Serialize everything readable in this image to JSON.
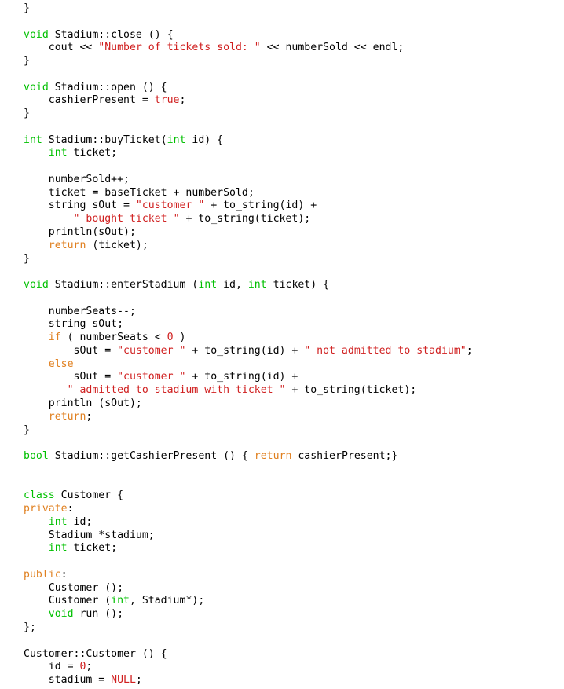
{
  "document": {
    "kind": "source-code-listing",
    "language": "C++",
    "background_color": "#ffffff"
  },
  "theme": {
    "plain_color": "#000000",
    "keyword_color": "#00c000",
    "string_color": "#d02020",
    "literal_color": "#d02020",
    "control_color": "#e08020"
  },
  "code": {
    "lines": [
      [
        {
          "t": "}",
          "c": "pln"
        }
      ],
      [],
      [
        {
          "t": "void",
          "c": "kw"
        },
        {
          "t": " Stadium::close () {",
          "c": "pln"
        }
      ],
      [
        {
          "t": "    cout << ",
          "c": "pln"
        },
        {
          "t": "\"Number of tickets sold: \"",
          "c": "str"
        },
        {
          "t": " << numberSold << endl;",
          "c": "pln"
        }
      ],
      [
        {
          "t": "}",
          "c": "pln"
        }
      ],
      [],
      [
        {
          "t": "void",
          "c": "kw"
        },
        {
          "t": " Stadium::open () {",
          "c": "pln"
        }
      ],
      [
        {
          "t": "    cashierPresent = ",
          "c": "pln"
        },
        {
          "t": "true",
          "c": "lit"
        },
        {
          "t": ";",
          "c": "pln"
        }
      ],
      [
        {
          "t": "}",
          "c": "pln"
        }
      ],
      [],
      [
        {
          "t": "int",
          "c": "kw"
        },
        {
          "t": " Stadium::buyTicket(",
          "c": "pln"
        },
        {
          "t": "int",
          "c": "kw"
        },
        {
          "t": " id) {",
          "c": "pln"
        }
      ],
      [
        {
          "t": "    ",
          "c": "pln"
        },
        {
          "t": "int",
          "c": "kw"
        },
        {
          "t": " ticket;",
          "c": "pln"
        }
      ],
      [],
      [
        {
          "t": "    numberSold++;",
          "c": "pln"
        }
      ],
      [
        {
          "t": "    ticket = baseTicket + numberSold;",
          "c": "pln"
        }
      ],
      [
        {
          "t": "    string sOut = ",
          "c": "pln"
        },
        {
          "t": "\"customer \"",
          "c": "str"
        },
        {
          "t": " + to_string(id) +",
          "c": "pln"
        }
      ],
      [
        {
          "t": "        ",
          "c": "pln"
        },
        {
          "t": "\" bought ticket \"",
          "c": "str"
        },
        {
          "t": " + to_string(ticket);",
          "c": "pln"
        }
      ],
      [
        {
          "t": "    println(sOut);",
          "c": "pln"
        }
      ],
      [
        {
          "t": "    ",
          "c": "pln"
        },
        {
          "t": "return",
          "c": "ctl"
        },
        {
          "t": " (ticket);",
          "c": "pln"
        }
      ],
      [
        {
          "t": "}",
          "c": "pln"
        }
      ],
      [],
      [
        {
          "t": "void",
          "c": "kw"
        },
        {
          "t": " Stadium::enterStadium (",
          "c": "pln"
        },
        {
          "t": "int",
          "c": "kw"
        },
        {
          "t": " id, ",
          "c": "pln"
        },
        {
          "t": "int",
          "c": "kw"
        },
        {
          "t": " ticket) {",
          "c": "pln"
        }
      ],
      [],
      [
        {
          "t": "    numberSeats--;",
          "c": "pln"
        }
      ],
      [
        {
          "t": "    string sOut;",
          "c": "pln"
        }
      ],
      [
        {
          "t": "    ",
          "c": "pln"
        },
        {
          "t": "if",
          "c": "ctl"
        },
        {
          "t": " ( numberSeats < ",
          "c": "pln"
        },
        {
          "t": "0",
          "c": "lit"
        },
        {
          "t": " )",
          "c": "pln"
        }
      ],
      [
        {
          "t": "        sOut = ",
          "c": "pln"
        },
        {
          "t": "\"customer \"",
          "c": "str"
        },
        {
          "t": " + to_string(id) + ",
          "c": "pln"
        },
        {
          "t": "\" not admitted to stadium\"",
          "c": "str"
        },
        {
          "t": ";",
          "c": "pln"
        }
      ],
      [
        {
          "t": "    ",
          "c": "pln"
        },
        {
          "t": "else",
          "c": "ctl"
        }
      ],
      [
        {
          "t": "        sOut = ",
          "c": "pln"
        },
        {
          "t": "\"customer \"",
          "c": "str"
        },
        {
          "t": " + to_string(id) +",
          "c": "pln"
        }
      ],
      [
        {
          "t": "       ",
          "c": "pln"
        },
        {
          "t": "\" admitted to stadium with ticket \"",
          "c": "str"
        },
        {
          "t": " + to_string(ticket);",
          "c": "pln"
        }
      ],
      [
        {
          "t": "    println (sOut);",
          "c": "pln"
        }
      ],
      [
        {
          "t": "    ",
          "c": "pln"
        },
        {
          "t": "return",
          "c": "ctl"
        },
        {
          "t": ";",
          "c": "pln"
        }
      ],
      [
        {
          "t": "}",
          "c": "pln"
        }
      ],
      [],
      [
        {
          "t": "bool",
          "c": "kw"
        },
        {
          "t": " Stadium::getCashierPresent () { ",
          "c": "pln"
        },
        {
          "t": "return",
          "c": "ctl"
        },
        {
          "t": " cashierPresent;}",
          "c": "pln"
        }
      ],
      [],
      [],
      [
        {
          "t": "class",
          "c": "kw"
        },
        {
          "t": " Customer {",
          "c": "pln"
        }
      ],
      [
        {
          "t": "private",
          "c": "ctl"
        },
        {
          "t": ":",
          "c": "pln"
        }
      ],
      [
        {
          "t": "    ",
          "c": "pln"
        },
        {
          "t": "int",
          "c": "kw"
        },
        {
          "t": " id;",
          "c": "pln"
        }
      ],
      [
        {
          "t": "    Stadium *stadium;",
          "c": "pln"
        }
      ],
      [
        {
          "t": "    ",
          "c": "pln"
        },
        {
          "t": "int",
          "c": "kw"
        },
        {
          "t": " ticket;",
          "c": "pln"
        }
      ],
      [],
      [
        {
          "t": "public",
          "c": "ctl"
        },
        {
          "t": ":",
          "c": "pln"
        }
      ],
      [
        {
          "t": "    Customer ();",
          "c": "pln"
        }
      ],
      [
        {
          "t": "    Customer (",
          "c": "pln"
        },
        {
          "t": "int",
          "c": "kw"
        },
        {
          "t": ", Stadium*);",
          "c": "pln"
        }
      ],
      [
        {
          "t": "    ",
          "c": "pln"
        },
        {
          "t": "void",
          "c": "kw"
        },
        {
          "t": " run ();",
          "c": "pln"
        }
      ],
      [
        {
          "t": "};",
          "c": "pln"
        }
      ],
      [],
      [
        {
          "t": "Customer::Customer () {",
          "c": "pln"
        }
      ],
      [
        {
          "t": "    id = ",
          "c": "pln"
        },
        {
          "t": "0",
          "c": "lit"
        },
        {
          "t": ";",
          "c": "pln"
        }
      ],
      [
        {
          "t": "    stadium = ",
          "c": "pln"
        },
        {
          "t": "NULL",
          "c": "lit"
        },
        {
          "t": ";",
          "c": "pln"
        }
      ]
    ]
  }
}
